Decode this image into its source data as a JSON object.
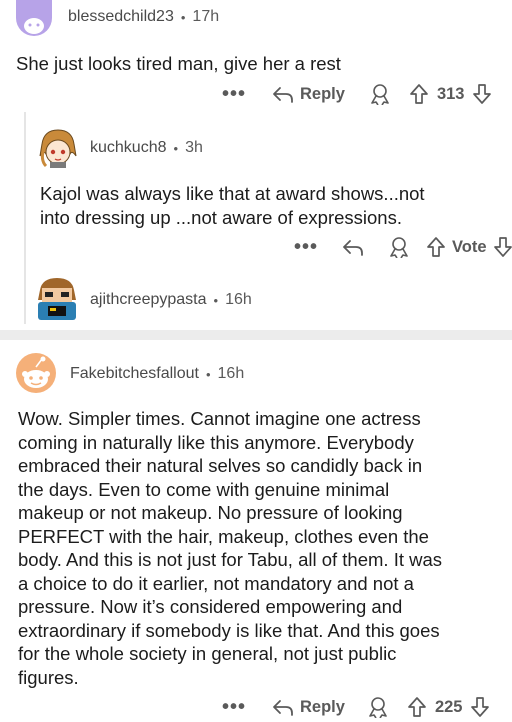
{
  "comments": [
    {
      "username": "blessedchild23",
      "age": "17h",
      "body": "She just looks tired man, give her a rest",
      "reply_label": "Reply",
      "score": "313"
    },
    {
      "username": "kuchkuch8",
      "age": "3h",
      "body_lines": [
        "Kajol was always like that at award shows...not",
        "into dressing up ...not aware of expressions."
      ],
      "vote_label": "Vote"
    },
    {
      "username": "ajithcreepypasta",
      "age": "16h"
    },
    {
      "username": "Fakebitchesfallout",
      "age": "16h",
      "body_lines": [
        "Wow. Simpler times. Cannot imagine one actress",
        "coming in naturally like this anymore. Everybody",
        "embraced their natural selves so candidly back in",
        "the days. Even to come with genuine minimal",
        "makeup or not makeup. No pressure of looking",
        "PERFECT with the hair, makeup, clothes even the",
        "body. And this is not just for Tabu, all of them. It was",
        "a choice to do it earlier, not mandatory and not a",
        "pressure. Now it’s considered empowering and",
        "extraordinary if somebody is like that. And this goes",
        "for the whole society in general, not just public",
        "figures."
      ],
      "reply_label": "Reply",
      "score": "225"
    }
  ],
  "separator": "•",
  "more_glyph": "•••",
  "icons": [
    "more-options-icon",
    "reply-arrow-icon",
    "award-icon",
    "upvote-arrow-icon",
    "downvote-arrow-icon"
  ],
  "colors": {
    "text": "#1c1c1c",
    "meta": "#5a5a5a",
    "divider": "#ececec",
    "thread": "#e5e5e5",
    "avatar1": "#b7a3e8",
    "avatar4": "#f5b079"
  }
}
